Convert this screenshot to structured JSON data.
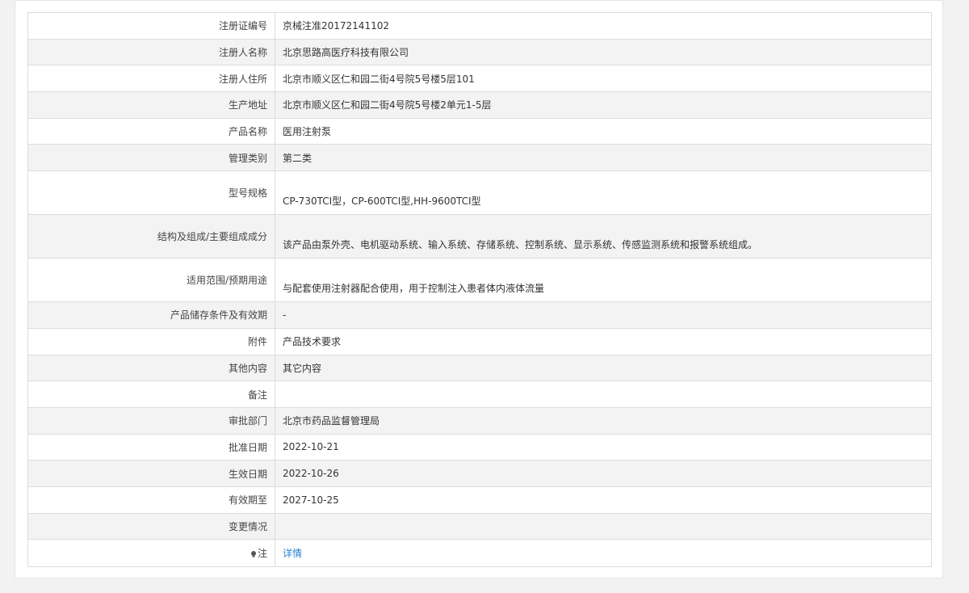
{
  "rows": [
    {
      "label": "注册证编号",
      "value": "京械注准20172141102"
    },
    {
      "label": "注册人名称",
      "value": "北京思路高医疗科技有限公司"
    },
    {
      "label": "注册人住所",
      "value": "北京市顺义区仁和园二街4号院5号楼5层101"
    },
    {
      "label": "生产地址",
      "value": "北京市顺义区仁和园二街4号院5号楼2单元1-5层"
    },
    {
      "label": "产品名称",
      "value": "医用注射泵"
    },
    {
      "label": "管理类别",
      "value": "第二类"
    },
    {
      "label": "型号规格",
      "value": "CP-730TCI型，CP-600TCI型,HH-9600TCI型"
    },
    {
      "label": "结构及组成/主要组成成分",
      "value": "该产品由泵外壳、电机驱动系统、输入系统、存储系统、控制系统、显示系统、传感监测系统和报警系统组成。"
    },
    {
      "label": "适用范围/预期用途",
      "value": "与配套使用注射器配合使用，用于控制注入患者体内液体流量"
    },
    {
      "label": "产品储存条件及有效期",
      "value": "-"
    },
    {
      "label": "附件",
      "value": "产品技术要求"
    },
    {
      "label": "其他内容",
      "value": "其它内容"
    },
    {
      "label": "备注",
      "value": ""
    },
    {
      "label": "审批部门",
      "value": "北京市药品监督管理局"
    },
    {
      "label": "批准日期",
      "value": "2022-10-21"
    },
    {
      "label": "生效日期",
      "value": "2022-10-26"
    },
    {
      "label": "有效期至",
      "value": "2027-10-25"
    },
    {
      "label": "变更情况",
      "value": ""
    }
  ],
  "note": {
    "label": "注",
    "icon": "lightbulb-icon",
    "link_text": "详情"
  },
  "colors": {
    "link": "#2b7fd1",
    "row_alt": "#f3f3f3",
    "border": "#dcdcdc"
  }
}
